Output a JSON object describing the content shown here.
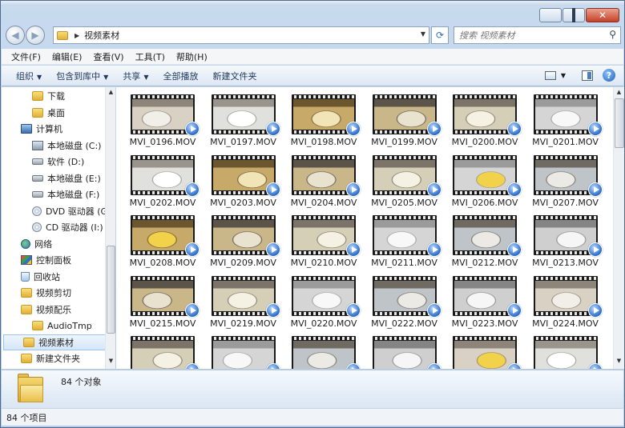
{
  "window": {
    "address": {
      "segments": [
        "视频素材"
      ]
    },
    "search": {
      "placeholder": "搜索 视频素材"
    }
  },
  "menubar": [
    "文件(F)",
    "编辑(E)",
    "查看(V)",
    "工具(T)",
    "帮助(H)"
  ],
  "toolbar": {
    "organize": "组织",
    "include_in_library": "包含到库中",
    "share": "共享",
    "play_all": "全部播放",
    "new_folder": "新建文件夹"
  },
  "nav": [
    {
      "label": "下载",
      "icon": "folder-icon",
      "indent": 2
    },
    {
      "label": "桌面",
      "icon": "folder-icon",
      "indent": 2
    },
    {
      "label": "计算机",
      "icon": "computer-icon",
      "indent": 1
    },
    {
      "label": "本地磁盘 (C:)",
      "icon": "system-drive-icon",
      "indent": 2
    },
    {
      "label": "软件 (D:)",
      "icon": "drive-icon",
      "indent": 2
    },
    {
      "label": "本地磁盘 (E:)",
      "icon": "drive-icon",
      "indent": 2
    },
    {
      "label": "本地磁盘 (F:)",
      "icon": "drive-icon",
      "indent": 2
    },
    {
      "label": "DVD 驱动器 (G",
      "icon": "disc-icon",
      "indent": 2
    },
    {
      "label": "CD 驱动器 (I:)",
      "icon": "disc-icon",
      "indent": 2
    },
    {
      "label": "网络",
      "icon": "network-icon",
      "indent": 1
    },
    {
      "label": "控制面板",
      "icon": "control-panel-icon",
      "indent": 1
    },
    {
      "label": "回收站",
      "icon": "recycle-bin-icon",
      "indent": 1
    },
    {
      "label": "视频剪切",
      "icon": "folder-icon",
      "indent": 1
    },
    {
      "label": "视频配乐",
      "icon": "folder-icon",
      "indent": 1
    },
    {
      "label": "AudioTmp",
      "icon": "folder-icon",
      "indent": 2
    },
    {
      "label": "视频素材",
      "icon": "folder-icon",
      "indent": 1,
      "selected": true
    },
    {
      "label": "新建文件夹",
      "icon": "folder-icon",
      "indent": 1
    }
  ],
  "files": [
    "MVI_0196.MOV",
    "MVI_0197.MOV",
    "MVI_0198.MOV",
    "MVI_0199.MOV",
    "MVI_0200.MOV",
    "MVI_0201.MOV",
    "MVI_0202.MOV",
    "MVI_0203.MOV",
    "MVI_0204.MOV",
    "MVI_0205.MOV",
    "MVI_0206.MOV",
    "MVI_0207.MOV",
    "MVI_0208.MOV",
    "MVI_0209.MOV",
    "MVI_0210.MOV",
    "MVI_0211.MOV",
    "MVI_0212.MOV",
    "MVI_0213.MOV",
    "MVI_0215.MOV",
    "MVI_0219.MOV",
    "MVI_0220.MOV",
    "MVI_0222.MOV",
    "MVI_0223.MOV",
    "MVI_0224.MOV",
    "",
    "",
    "",
    "",
    "",
    ""
  ],
  "details": {
    "summary": "84 个对象"
  },
  "status": {
    "items": "84 个项目"
  }
}
